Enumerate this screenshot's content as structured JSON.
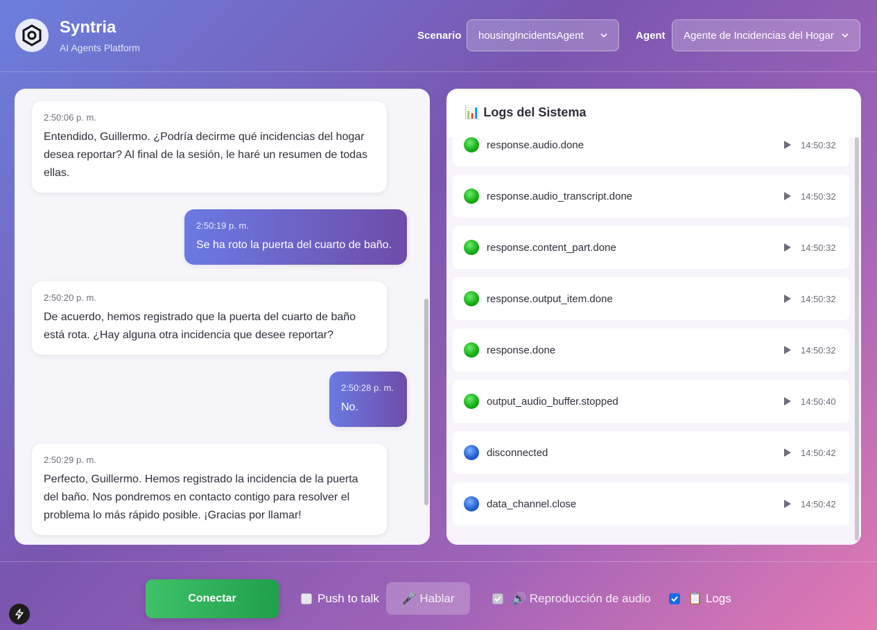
{
  "header": {
    "brand_title": "Syntria",
    "brand_subtitle": "AI Agents Platform",
    "scenario_label": "Scenario",
    "scenario_value": "housingIncidentsAgent",
    "agent_label": "Agent",
    "agent_value": "Agente de Incidencias del Hogar"
  },
  "chat": {
    "messages": [
      {
        "role": "agent",
        "time": "2:50:06 p. m.",
        "text": "Entendido, Guillermo. ¿Podría decirme qué incidencias del hogar desea reportar? Al final de la sesión, le haré un resumen de todas ellas."
      },
      {
        "role": "user",
        "time": "2:50:19 p. m.",
        "text": "Se ha roto la puerta del cuarto de baño."
      },
      {
        "role": "agent",
        "time": "2:50:20 p. m.",
        "text": "De acuerdo, hemos registrado que la puerta del cuarto de baño está rota. ¿Hay alguna otra incidencia que desee reportar?"
      },
      {
        "role": "user",
        "time": "2:50:28 p. m.",
        "text": "No."
      },
      {
        "role": "agent",
        "time": "2:50:29 p. m.",
        "text": "Perfecto, Guillermo. Hemos registrado la incidencia de la puerta del baño. Nos pondremos en contacto contigo para resolver el problema lo más rápido posible. ¡Gracias por llamar!"
      }
    ]
  },
  "logs": {
    "title": "📊 Logs del Sistema",
    "items": [
      {
        "name": "response.audio.done",
        "time": "14:50:32",
        "status": "green"
      },
      {
        "name": "response.audio_transcript.done",
        "time": "14:50:32",
        "status": "green"
      },
      {
        "name": "response.content_part.done",
        "time": "14:50:32",
        "status": "green"
      },
      {
        "name": "response.output_item.done",
        "time": "14:50:32",
        "status": "green"
      },
      {
        "name": "response.done",
        "time": "14:50:32",
        "status": "green"
      },
      {
        "name": "output_audio_buffer.stopped",
        "time": "14:50:40",
        "status": "green"
      },
      {
        "name": "disconnected",
        "time": "14:50:42",
        "status": "blue"
      },
      {
        "name": "data_channel.close",
        "time": "14:50:42",
        "status": "blue"
      }
    ]
  },
  "footer": {
    "connect_label": "Conectar",
    "push_to_talk_label": "Push to talk",
    "push_to_talk_checked": false,
    "talk_label": "🎤 Hablar",
    "audio_playback_label": "🔊 Reproducción de audio",
    "audio_playback_checked": true,
    "logs_label": "📋 Logs",
    "logs_checked": true
  }
}
